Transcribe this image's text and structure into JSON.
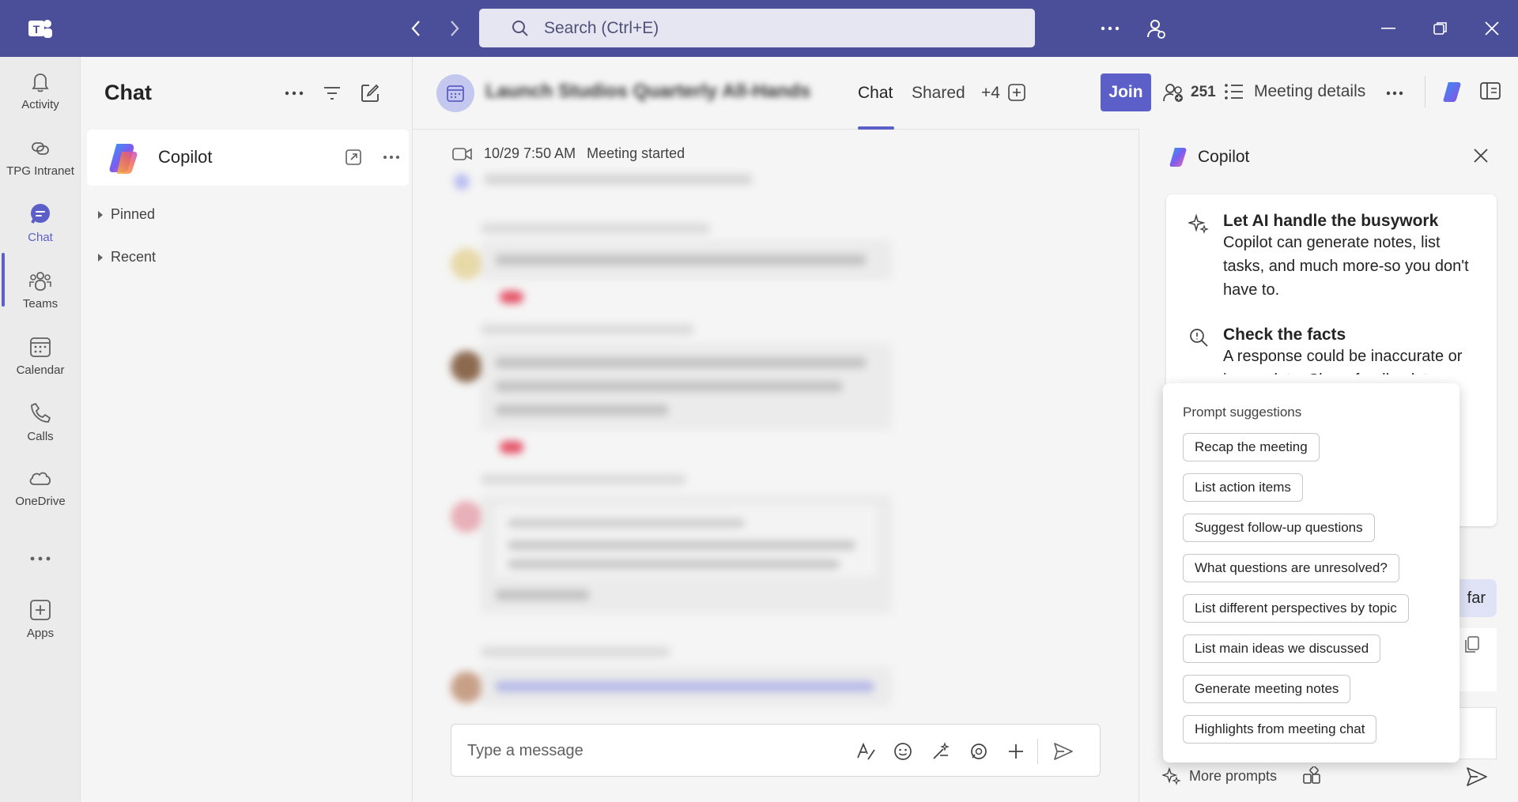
{
  "titlebar": {
    "search_placeholder": "Search (Ctrl+E)",
    "bg_color": "#4b4f99"
  },
  "rail": {
    "items": [
      {
        "label": "Activity",
        "icon": "bell-icon"
      },
      {
        "label": "TPG Intranet",
        "icon": "link-icon"
      },
      {
        "label": "Chat",
        "icon": "chat-icon"
      },
      {
        "label": "Teams",
        "icon": "teams-icon"
      },
      {
        "label": "Calendar",
        "icon": "calendar-icon"
      },
      {
        "label": "Calls",
        "icon": "phone-icon"
      },
      {
        "label": "OneDrive",
        "icon": "cloud-icon"
      },
      {
        "label": "Apps",
        "icon": "add-app-icon"
      }
    ],
    "active": "Chat"
  },
  "chatlist": {
    "title": "Chat",
    "copilot_name": "Copilot",
    "sections": [
      "Pinned",
      "Recent"
    ]
  },
  "meeting": {
    "title": "Launch Studios Quarterly All-Hands",
    "tabs": [
      "Chat",
      "Shared",
      "+4"
    ],
    "join_label": "Join",
    "participants_count": "251",
    "details_label": "Meeting details",
    "system_time": "10/29 7:50 AM",
    "system_text": "Meeting started",
    "composer_placeholder": "Type a message"
  },
  "copilot": {
    "title": "Copilot",
    "features": [
      {
        "heading": "Let AI handle the busywork",
        "text": "Copilot can generate notes, list tasks, and much more-so you don't have to."
      },
      {
        "heading": "Check the facts",
        "text": "A response could be inaccurate or incomplete. Share feedback to"
      }
    ],
    "user_bubble_fragment": "far",
    "prompt_title": "Prompt suggestions",
    "prompts": [
      "Recap the meeting",
      "List action items",
      "Suggest follow-up questions",
      "What questions are unresolved?",
      "List different perspectives by topic",
      "List main ideas we discussed",
      "Generate meeting notes",
      "Highlights from meeting chat"
    ],
    "more_prompts": "More prompts"
  },
  "colors": {
    "accent": "#5b5fc7",
    "join_bg": "#5b5fc7"
  }
}
